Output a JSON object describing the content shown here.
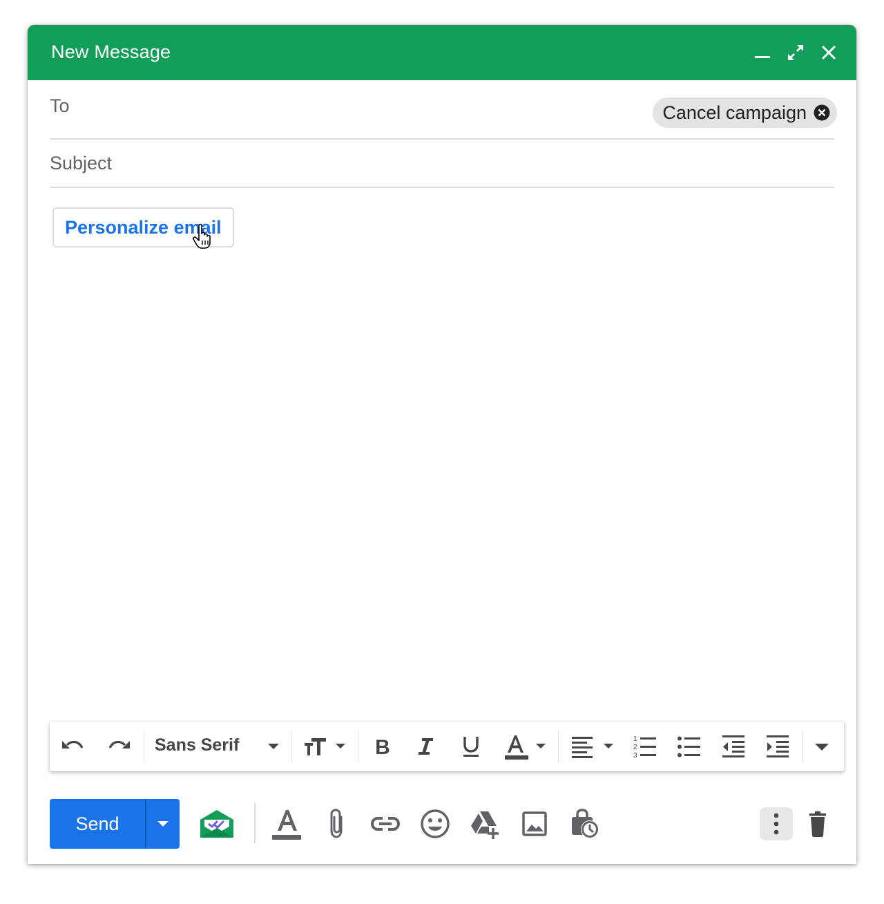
{
  "window": {
    "title": "New Message"
  },
  "colors": {
    "header": "#129e58",
    "accent": "#1a73e8",
    "chip_bg": "#e2e3e5"
  },
  "recipients": {
    "label": "To",
    "chips": [
      {
        "label": "Cancel campaign"
      }
    ]
  },
  "subject": {
    "placeholder": "Subject",
    "value": ""
  },
  "body": {
    "personalize_button": "Personalize email"
  },
  "formatting": {
    "font": "Sans Serif"
  },
  "actions": {
    "send_label": "Send"
  },
  "icons": {
    "titlebar": [
      "minimize-icon",
      "expand-icon",
      "close-icon"
    ],
    "toolbar": [
      "undo-icon",
      "redo-icon",
      "font-size-icon",
      "bold-icon",
      "italic-icon",
      "underline-icon",
      "text-color-icon",
      "align-icon",
      "numbered-list-icon",
      "bulleted-list-icon",
      "indent-less-icon",
      "indent-more-icon",
      "more-formatting-icon"
    ],
    "bottom": [
      "mail-merge-icon",
      "formatting-options-icon",
      "attach-icon",
      "link-icon",
      "emoji-icon",
      "drive-icon",
      "photo-icon",
      "schedule-icon",
      "more-options-icon",
      "trash-icon"
    ]
  }
}
